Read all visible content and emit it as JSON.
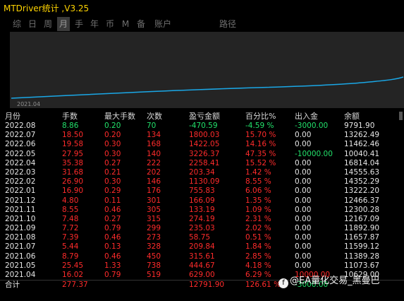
{
  "window": {
    "title": "MTDriver统计 ,V3.25"
  },
  "tabs": [
    {
      "label": "综",
      "active": false
    },
    {
      "label": "日",
      "active": false
    },
    {
      "label": "周",
      "active": false
    },
    {
      "label": "月",
      "active": true
    },
    {
      "label": "手",
      "active": false
    },
    {
      "label": "年",
      "active": false
    },
    {
      "label": "币",
      "active": false
    },
    {
      "label": "M",
      "active": false
    },
    {
      "label": "备",
      "active": false
    },
    {
      "label": "账户",
      "active": false
    },
    {
      "label": "路径",
      "active": false
    }
  ],
  "chart": {
    "date_label": "2021.04",
    "line_color": "#1aa7e6",
    "bg_color": "#242424"
  },
  "table": {
    "headers": [
      "月份",
      "手数",
      "最大手数",
      "次数",
      "盈亏金额",
      "百分比%",
      "出入金",
      "余额"
    ],
    "rows": [
      [
        "2022.08",
        "8.86",
        "0.20",
        "70",
        "-470.59",
        "-4.59 %",
        "-3000.00",
        "9791.90"
      ],
      [
        "2022.07",
        "18.50",
        "0.20",
        "134",
        "1800.03",
        "15.70 %",
        "0.00",
        "13262.49"
      ],
      [
        "2022.06",
        "19.58",
        "0.30",
        "168",
        "1422.05",
        "14.16 %",
        "0.00",
        "11462.46"
      ],
      [
        "2022.05",
        "27.95",
        "0.30",
        "140",
        "3226.37",
        "47.35 %",
        "-10000.00",
        "10040.41"
      ],
      [
        "2022.04",
        "35.38",
        "0.27",
        "222",
        "2258.41",
        "15.52 %",
        "0.00",
        "16814.04"
      ],
      [
        "2022.03",
        "31.68",
        "0.21",
        "202",
        "203.34",
        "1.42 %",
        "0.00",
        "14555.63"
      ],
      [
        "2022.02",
        "26.90",
        "0.30",
        "146",
        "1130.09",
        "8.55 %",
        "0.00",
        "14352.29"
      ],
      [
        "2022.01",
        "16.90",
        "0.29",
        "176",
        "755.83",
        "6.06 %",
        "0.00",
        "13222.20"
      ],
      [
        "2021.12",
        "4.80",
        "0.11",
        "301",
        "166.09",
        "1.35 %",
        "0.00",
        "12466.37"
      ],
      [
        "2021.11",
        "8.55",
        "0.46",
        "305",
        "133.19",
        "1.09 %",
        "0.00",
        "12300.28"
      ],
      [
        "2021.10",
        "7.48",
        "0.27",
        "315",
        "274.19",
        "2.31 %",
        "0.00",
        "12167.09"
      ],
      [
        "2021.09",
        "7.72",
        "0.79",
        "299",
        "235.03",
        "2.02 %",
        "0.00",
        "11892.90"
      ],
      [
        "2021.08",
        "7.39",
        "0.46",
        "273",
        "58.75",
        "0.51 %",
        "0.00",
        "11657.87"
      ],
      [
        "2021.07",
        "5.44",
        "0.13",
        "328",
        "209.84",
        "1.84 %",
        "0.00",
        "11599.12"
      ],
      [
        "2021.06",
        "8.79",
        "0.46",
        "450",
        "315.61",
        "2.85 %",
        "0.00",
        "11389.28"
      ],
      [
        "2021.05",
        "25.45",
        "1.33",
        "738",
        "444.67",
        "4.18 %",
        "0.00",
        "11073.67"
      ],
      [
        "2021.04",
        "16.02",
        "0.79",
        "519",
        "629.00",
        "6.29 %",
        "10000.00",
        "10629.00"
      ]
    ],
    "total": [
      "合计",
      "277.37",
      "",
      "",
      "12791.90",
      "126.61 %",
      "-3000.00",
      ""
    ]
  },
  "watermark": {
    "text": "@EA量化交易_黑曼巴"
  },
  "colors": {
    "title": "#ffd400",
    "positive_row": "#ff2b2b",
    "negative_row": "#22e06a"
  }
}
